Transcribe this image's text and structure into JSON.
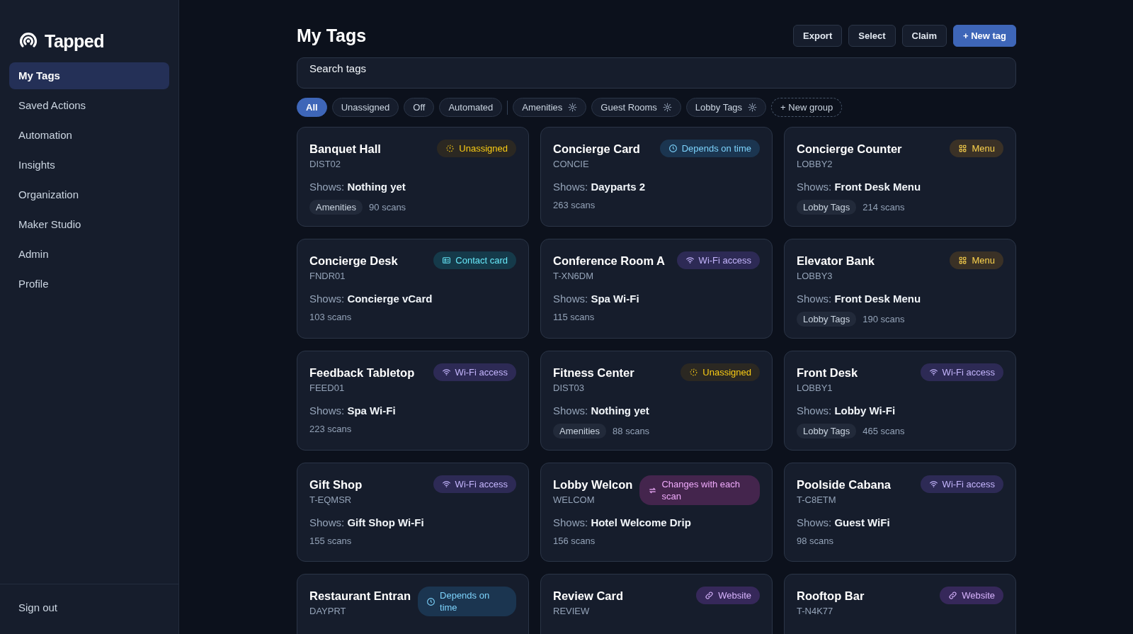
{
  "brand": {
    "name": "Tapped"
  },
  "sidebar": {
    "items": [
      {
        "label": "My Tags",
        "selected": true
      },
      {
        "label": "Saved Actions",
        "selected": false
      },
      {
        "label": "Automation",
        "selected": false
      },
      {
        "label": "Insights",
        "selected": false
      },
      {
        "label": "Organization",
        "selected": false
      },
      {
        "label": "Maker Studio",
        "selected": false
      },
      {
        "label": "Admin",
        "selected": false
      },
      {
        "label": "Profile",
        "selected": false
      }
    ],
    "footer": "Sign out"
  },
  "page": {
    "title": "My Tags",
    "actions": [
      {
        "label": "Export",
        "kind": "secondary"
      },
      {
        "label": "Select",
        "kind": "secondary"
      },
      {
        "label": "Claim",
        "kind": "secondary"
      },
      {
        "label": "+ New tag",
        "kind": "primary"
      }
    ]
  },
  "search": {
    "placeholder": "Search tags"
  },
  "filters": [
    {
      "label": "All",
      "kind": "status",
      "selected": true
    },
    {
      "label": "Unassigned",
      "kind": "status",
      "selected": false
    },
    {
      "label": "Off",
      "kind": "status",
      "selected": false
    },
    {
      "label": "Automated",
      "kind": "status",
      "selected": false
    },
    {
      "label": "Amenities",
      "kind": "group",
      "selected": false
    },
    {
      "label": "Guest Rooms",
      "kind": "group",
      "selected": false
    },
    {
      "label": "Lobby Tags",
      "kind": "group",
      "selected": false
    },
    {
      "label": "+ New group",
      "kind": "new",
      "selected": false
    }
  ],
  "tags": [
    {
      "name": "Banquet Hall",
      "code": "DIST02",
      "badge": {
        "kind": "unassigned",
        "label": "Unassigned"
      },
      "shows_label": "Shows:",
      "shows": "Nothing yet",
      "group": "Amenities",
      "scans": "90 scans"
    },
    {
      "name": "Concierge Card",
      "code": "CONCIE",
      "badge": {
        "kind": "time",
        "label": "Depends on time"
      },
      "shows_label": "Shows:",
      "shows": "Dayparts 2",
      "scans": "263 scans"
    },
    {
      "name": "Concierge Counter",
      "code": "LOBBY2",
      "badge": {
        "kind": "menu",
        "label": "Menu"
      },
      "shows_label": "Shows:",
      "shows": "Front Desk Menu",
      "group": "Lobby Tags",
      "scans": "214 scans"
    },
    {
      "name": "Concierge Desk",
      "code": "FNDR01",
      "badge": {
        "kind": "contact",
        "label": "Contact card"
      },
      "shows_label": "Shows:",
      "shows": "Concierge vCard",
      "scans": "103 scans"
    },
    {
      "name": "Conference Room A",
      "code": "T-XN6DM",
      "badge": {
        "kind": "wifi",
        "label": "Wi-Fi access"
      },
      "shows_label": "Shows:",
      "shows": "Spa Wi-Fi",
      "scans": "115 scans"
    },
    {
      "name": "Elevator Bank",
      "code": "LOBBY3",
      "badge": {
        "kind": "menu",
        "label": "Menu"
      },
      "shows_label": "Shows:",
      "shows": "Front Desk Menu",
      "group": "Lobby Tags",
      "scans": "190 scans"
    },
    {
      "name": "Feedback Tabletop",
      "code": "FEED01",
      "badge": {
        "kind": "wifi",
        "label": "Wi-Fi access"
      },
      "shows_label": "Shows:",
      "shows": "Spa Wi-Fi",
      "scans": "223 scans"
    },
    {
      "name": "Fitness Center",
      "code": "DIST03",
      "badge": {
        "kind": "unassigned",
        "label": "Unassigned"
      },
      "shows_label": "Shows:",
      "shows": "Nothing yet",
      "group": "Amenities",
      "scans": "88 scans"
    },
    {
      "name": "Front Desk",
      "code": "LOBBY1",
      "badge": {
        "kind": "wifi",
        "label": "Wi-Fi access"
      },
      "shows_label": "Shows:",
      "shows": "Lobby Wi-Fi",
      "group": "Lobby Tags",
      "scans": "465 scans"
    },
    {
      "name": "Gift Shop",
      "code": "T-EQMSR",
      "badge": {
        "kind": "wifi",
        "label": "Wi-Fi access"
      },
      "shows_label": "Shows:",
      "shows": "Gift Shop Wi-Fi",
      "scans": "155 scans"
    },
    {
      "name": "Lobby Welcon",
      "code": "WELCOM",
      "badge": {
        "kind": "rotate",
        "label": "Changes with each scan"
      },
      "shows_label": "Shows:",
      "shows": "Hotel Welcome Drip",
      "scans": "156 scans"
    },
    {
      "name": "Poolside Cabana",
      "code": "T-C8ETM",
      "badge": {
        "kind": "wifi",
        "label": "Wi-Fi access"
      },
      "shows_label": "Shows:",
      "shows": "Guest WiFi",
      "scans": "98 scans"
    },
    {
      "name": "Restaurant Entran",
      "code": "DAYPRT",
      "badge": {
        "kind": "time",
        "label": "Depends on time"
      }
    },
    {
      "name": "Review Card",
      "code": "REVIEW",
      "badge": {
        "kind": "link",
        "label": "Website"
      }
    },
    {
      "name": "Rooftop Bar",
      "code": "T-N4K77",
      "badge": {
        "kind": "link",
        "label": "Website"
      }
    }
  ]
}
